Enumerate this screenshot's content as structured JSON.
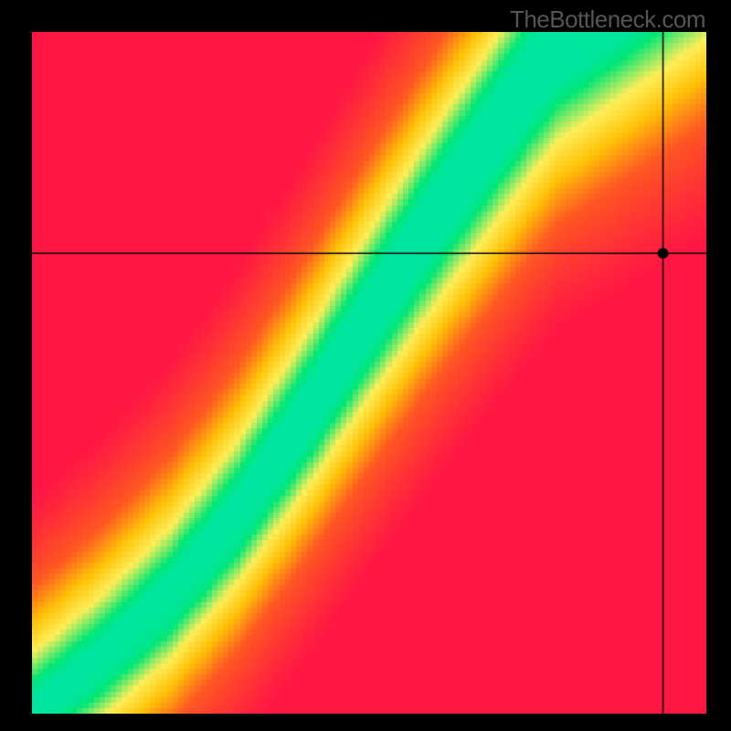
{
  "watermark": "TheBottleneck.com",
  "chart_data": {
    "type": "heatmap",
    "title": "",
    "xlabel": "",
    "ylabel": "",
    "xlim": [
      0,
      1
    ],
    "ylim": [
      0,
      1
    ],
    "marker": {
      "x": 0.937,
      "y": 0.675
    },
    "crosshair": {
      "x": 0.937,
      "y": 0.675
    },
    "optimal_curve": {
      "comment": "approximate centerline of the green optimal band, y as function of x (normalized 0-1)",
      "points": [
        [
          0.0,
          0.0
        ],
        [
          0.1,
          0.075
        ],
        [
          0.2,
          0.165
        ],
        [
          0.3,
          0.285
        ],
        [
          0.4,
          0.43
        ],
        [
          0.5,
          0.585
        ],
        [
          0.55,
          0.66
        ],
        [
          0.6,
          0.735
        ],
        [
          0.65,
          0.805
        ],
        [
          0.7,
          0.875
        ],
        [
          0.75,
          0.945
        ],
        [
          0.78,
          0.985
        ],
        [
          0.8,
          1.0
        ]
      ]
    },
    "colorscale": [
      {
        "stop": 0.0,
        "color": "#ff1744"
      },
      {
        "stop": 0.35,
        "color": "#ff5722"
      },
      {
        "stop": 0.55,
        "color": "#ffc107"
      },
      {
        "stop": 0.72,
        "color": "#ffee58"
      },
      {
        "stop": 0.9,
        "color": "#00e676"
      },
      {
        "stop": 1.0,
        "color": "#00e5a0"
      }
    ]
  }
}
